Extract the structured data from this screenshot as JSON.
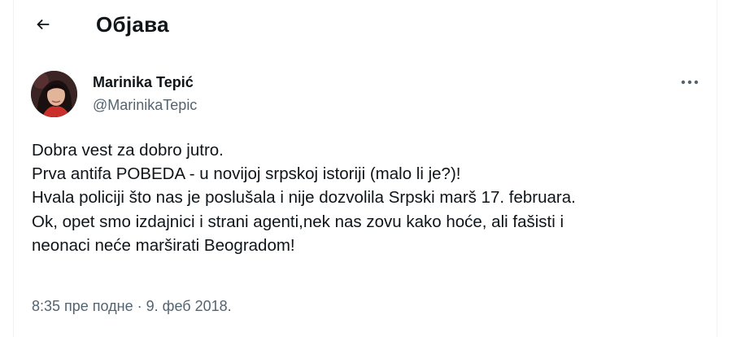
{
  "header": {
    "title": "Објава"
  },
  "author": {
    "name": "Marinika Tepić",
    "handle": "@MarinikaTepic"
  },
  "tweet": {
    "lines": [
      "Dobra vest za dobro jutro.",
      "Prva antifa POBEDA - u novijoj srpskoj istoriji (malo li je?)!",
      "Hvala policiji što nas je poslušala i nije dozvolila Srpski marš 17. februara.",
      "Ok, opet smo izdajnici i strani agenti,nek nas zovu kako hoće, ali fašisti i",
      "neonaci neće marširati Beogradom!"
    ],
    "time": "8:35 пре подне",
    "separator": "·",
    "date": "9. феб 2018."
  },
  "icons": {
    "back": "arrow-left-icon",
    "more": "more-horizontal-icon"
  },
  "colors": {
    "text_primary": "#0f1419",
    "text_secondary": "#536471",
    "border": "#eff3f4"
  }
}
